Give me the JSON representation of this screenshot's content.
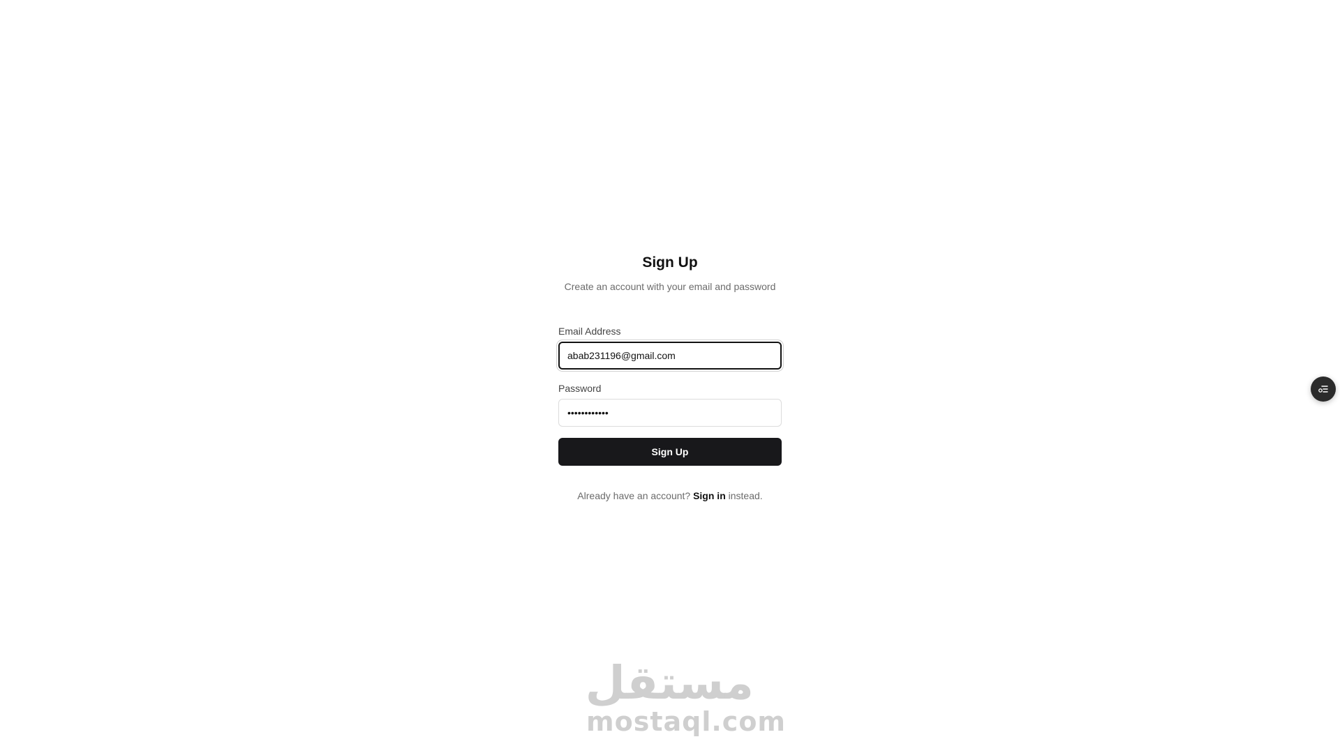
{
  "form": {
    "title": "Sign Up",
    "subtitle": "Create an account with your email and password",
    "email_label": "Email Address",
    "email_value": "abab231196@gmail.com",
    "password_label": "Password",
    "password_value": "••••••••••••",
    "submit_label": "Sign Up"
  },
  "footer": {
    "prefix": "Already have an account?",
    "link_label": "Sign in",
    "suffix": "instead."
  },
  "floating_button": {
    "icon": "list-settings-icon"
  },
  "watermark": {
    "arabic": "مستقل",
    "latin": "mostaql.com"
  },
  "colors": {
    "button_bg": "#18181b",
    "button_text": "#ffffff",
    "muted_text": "#6b6b6b",
    "input_border": "#dcdcdc",
    "focus_border": "#111111"
  }
}
